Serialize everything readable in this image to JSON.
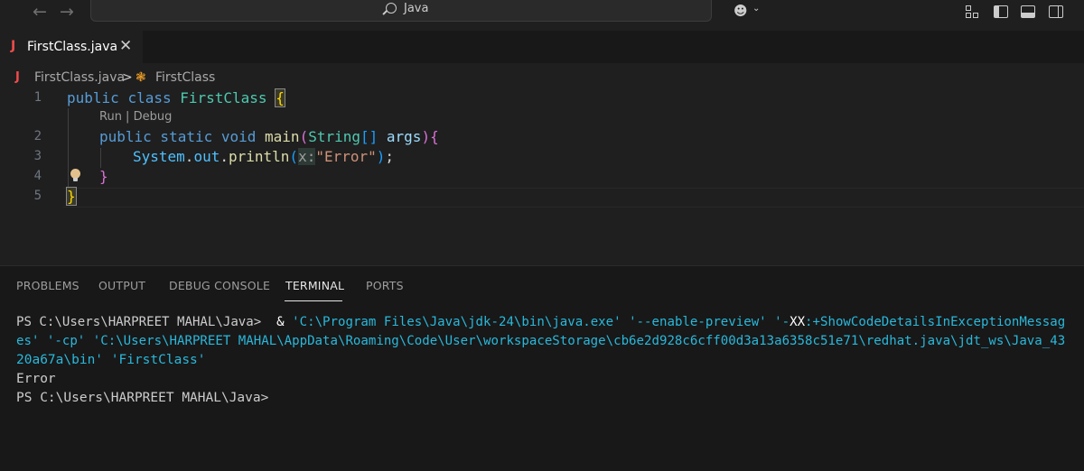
{
  "titlebar": {
    "back_arrow": "←",
    "forward_arrow": "→",
    "search_text": "Java",
    "copilot_glyph": "☻",
    "copilot_chevron": "⌄"
  },
  "tab": {
    "icon_letter": "J",
    "label": "FirstClass.java",
    "close_glyph": "✕"
  },
  "breadcrumb": {
    "file_icon": "J",
    "file": "FirstClass.java",
    "separator": ">",
    "symbol_icon": "❃",
    "symbol": "FirstClass"
  },
  "editor": {
    "line_numbers": [
      "1",
      "2",
      "3",
      "4",
      "5"
    ],
    "codelens": "Run | Debug",
    "lines": {
      "l1_public": "public ",
      "l1_class": "class ",
      "l1_name": "FirstClass ",
      "l1_brace": "{",
      "l2_mods": "public static void ",
      "l2_main": "main",
      "l2_paren_open": "(",
      "l2_type": "String",
      "l2_arr": "[]",
      "l2_args": " args",
      "l2_paren_close": ")",
      "l2_brace": "{",
      "l3_system": "System",
      "l3_dot1": ".",
      "l3_out": "out",
      "l3_dot2": ".",
      "l3_println": "println",
      "l3_paren_open": "(",
      "l3_hint": "x:",
      "l3_string": "\"Error\"",
      "l3_paren_close": ")",
      "l3_semi": ";",
      "l4_brace": "}",
      "l5_brace": "}"
    }
  },
  "panel": {
    "tabs": [
      "PROBLEMS",
      "OUTPUT",
      "DEBUG CONSOLE",
      "TERMINAL",
      "PORTS"
    ],
    "active_tab": "TERMINAL",
    "terminal": {
      "prompt1": "PS C:\\Users\\HARPREET MAHAL\\Java>",
      "cmd_amp": "  & ",
      "cmd_exe": "'C:\\Program Files\\Java\\jdk-24\\bin\\java.exe'",
      "cmd_preview": " '--enable-preview'",
      "cmd_xx_a": " '-",
      "cmd_xx_b": "XX",
      "cmd_xx_c": ":+ShowCodeDetailsInExceptionMessag",
      "wrap1": "es' '-cp' 'C:\\Users\\HARPREET MAHAL\\AppData\\Roaming\\Code\\User\\workspaceStorage\\cb6e2d928c6cff00d3a13a6358c51e71\\redhat.java\\jdt_ws\\Java_43",
      "wrap2": "20a67a\\bin' 'FirstClass'",
      "output": "Error",
      "prompt2": "PS C:\\Users\\HARPREET MAHAL\\Java>"
    }
  },
  "colors": {
    "editor_bg": "#1f1f1f",
    "panel_bg": "#181818",
    "keyword": "#569cd6",
    "class": "#4ec9b0",
    "string": "#ce9178",
    "java_icon": "#f14c4c"
  }
}
